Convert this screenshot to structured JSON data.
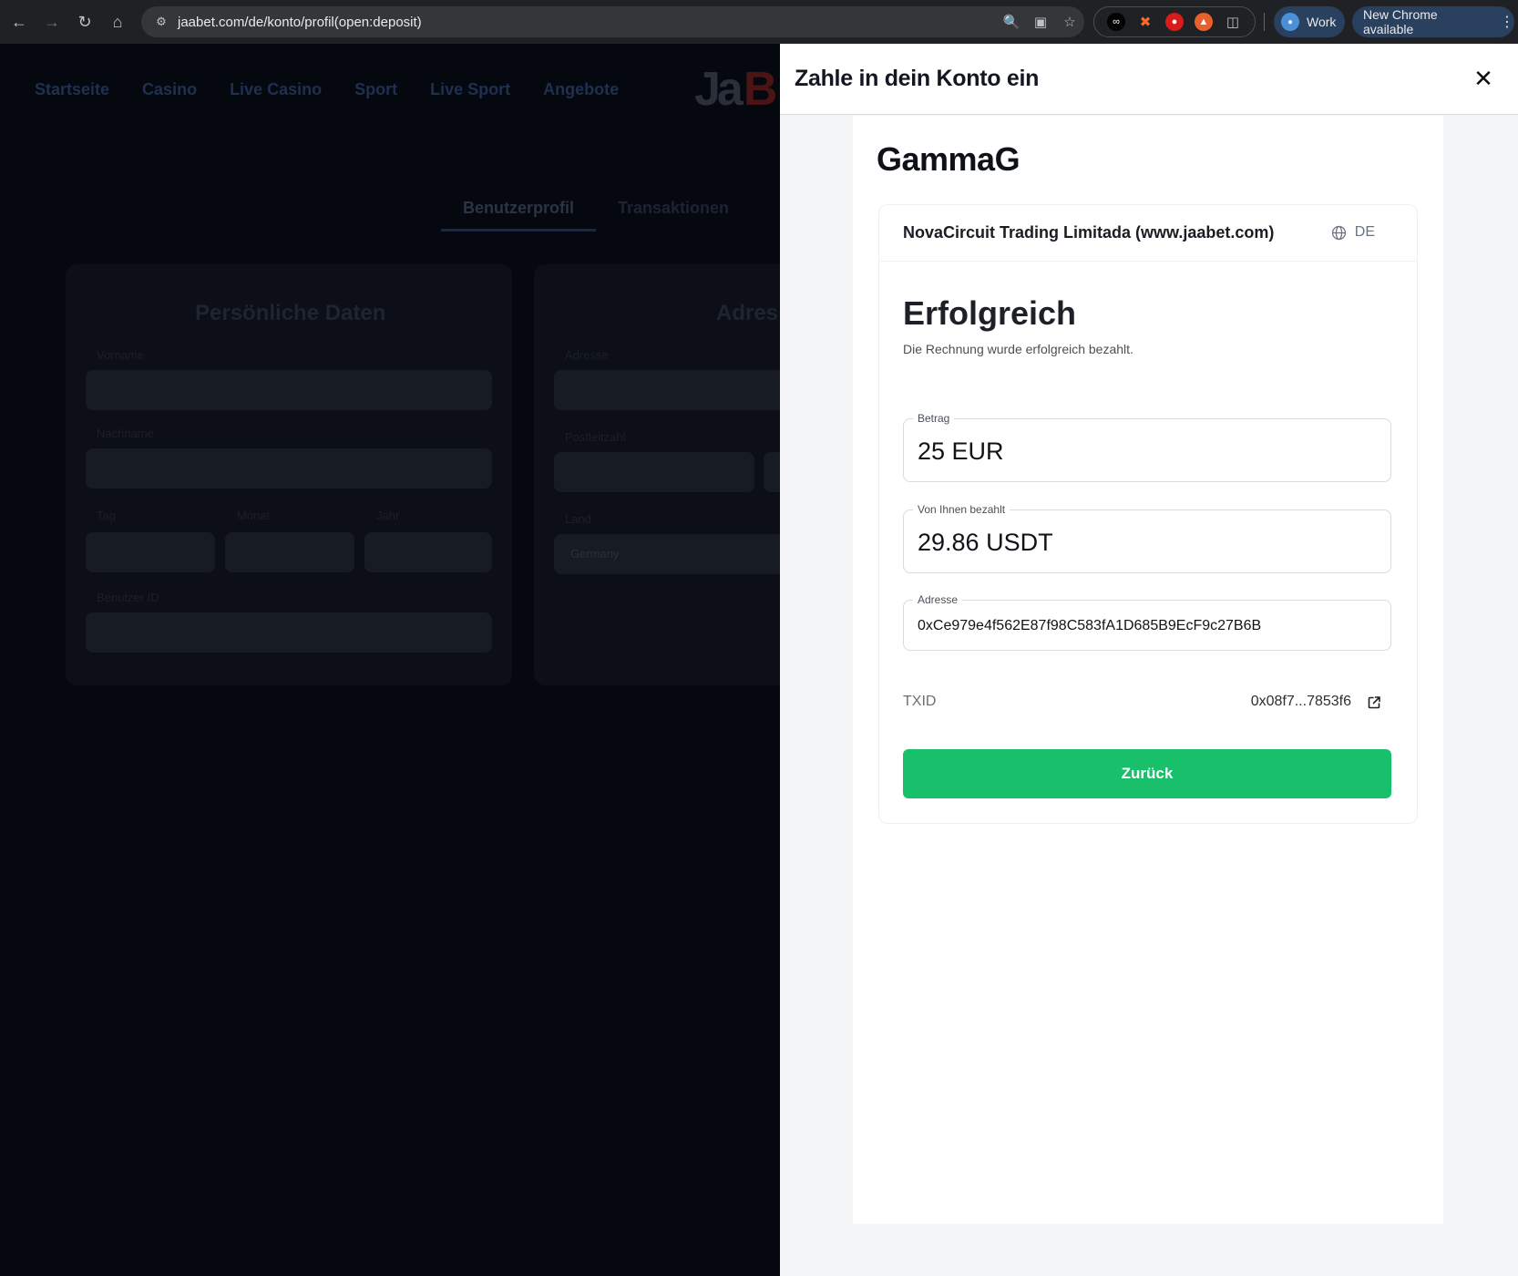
{
  "browser": {
    "url": "jaabet.com/de/konto/profil(open:deposit)",
    "profile_label": "Work",
    "update_label": "New Chrome available"
  },
  "site": {
    "nav": [
      "Startseite",
      "Casino",
      "Live Casino",
      "Sport",
      "Live Sport",
      "Angebote"
    ],
    "profile_tabs": [
      "Benutzerprofil",
      "Transaktionen"
    ],
    "personal_card": {
      "title": "Persönliche Daten",
      "labels": {
        "first_name": "Vorname",
        "last_name": "Nachname",
        "day": "Tag",
        "month": "Monat",
        "year": "Jahr",
        "user_id": "Benutzer ID"
      }
    },
    "address_card": {
      "title": "Adres",
      "labels": {
        "address": "Adresse",
        "postcode": "Postleitzahl",
        "country": "Land"
      },
      "country_value": "Germany"
    }
  },
  "drawer": {
    "title": "Zahle in dein Konto ein",
    "brand": "GammaG",
    "merchant": "NovaCircuit Trading Limitada (www.jaabet.com)",
    "language": "DE",
    "status_title": "Erfolgreich",
    "status_message": "Die Rechnung wurde erfolgreich bezahlt.",
    "amount": {
      "label": "Betrag",
      "value": "25 EUR"
    },
    "paid": {
      "label": "Von Ihnen bezahlt",
      "value": "29.86 USDT"
    },
    "address": {
      "label": "Adresse",
      "value": "0xCe979e4f562E87f98C583fA1D685B9EcF9c27B6B"
    },
    "txid": {
      "label": "TXID",
      "value": "0x08f7...7853f6"
    },
    "back_label": "Zurück"
  }
}
